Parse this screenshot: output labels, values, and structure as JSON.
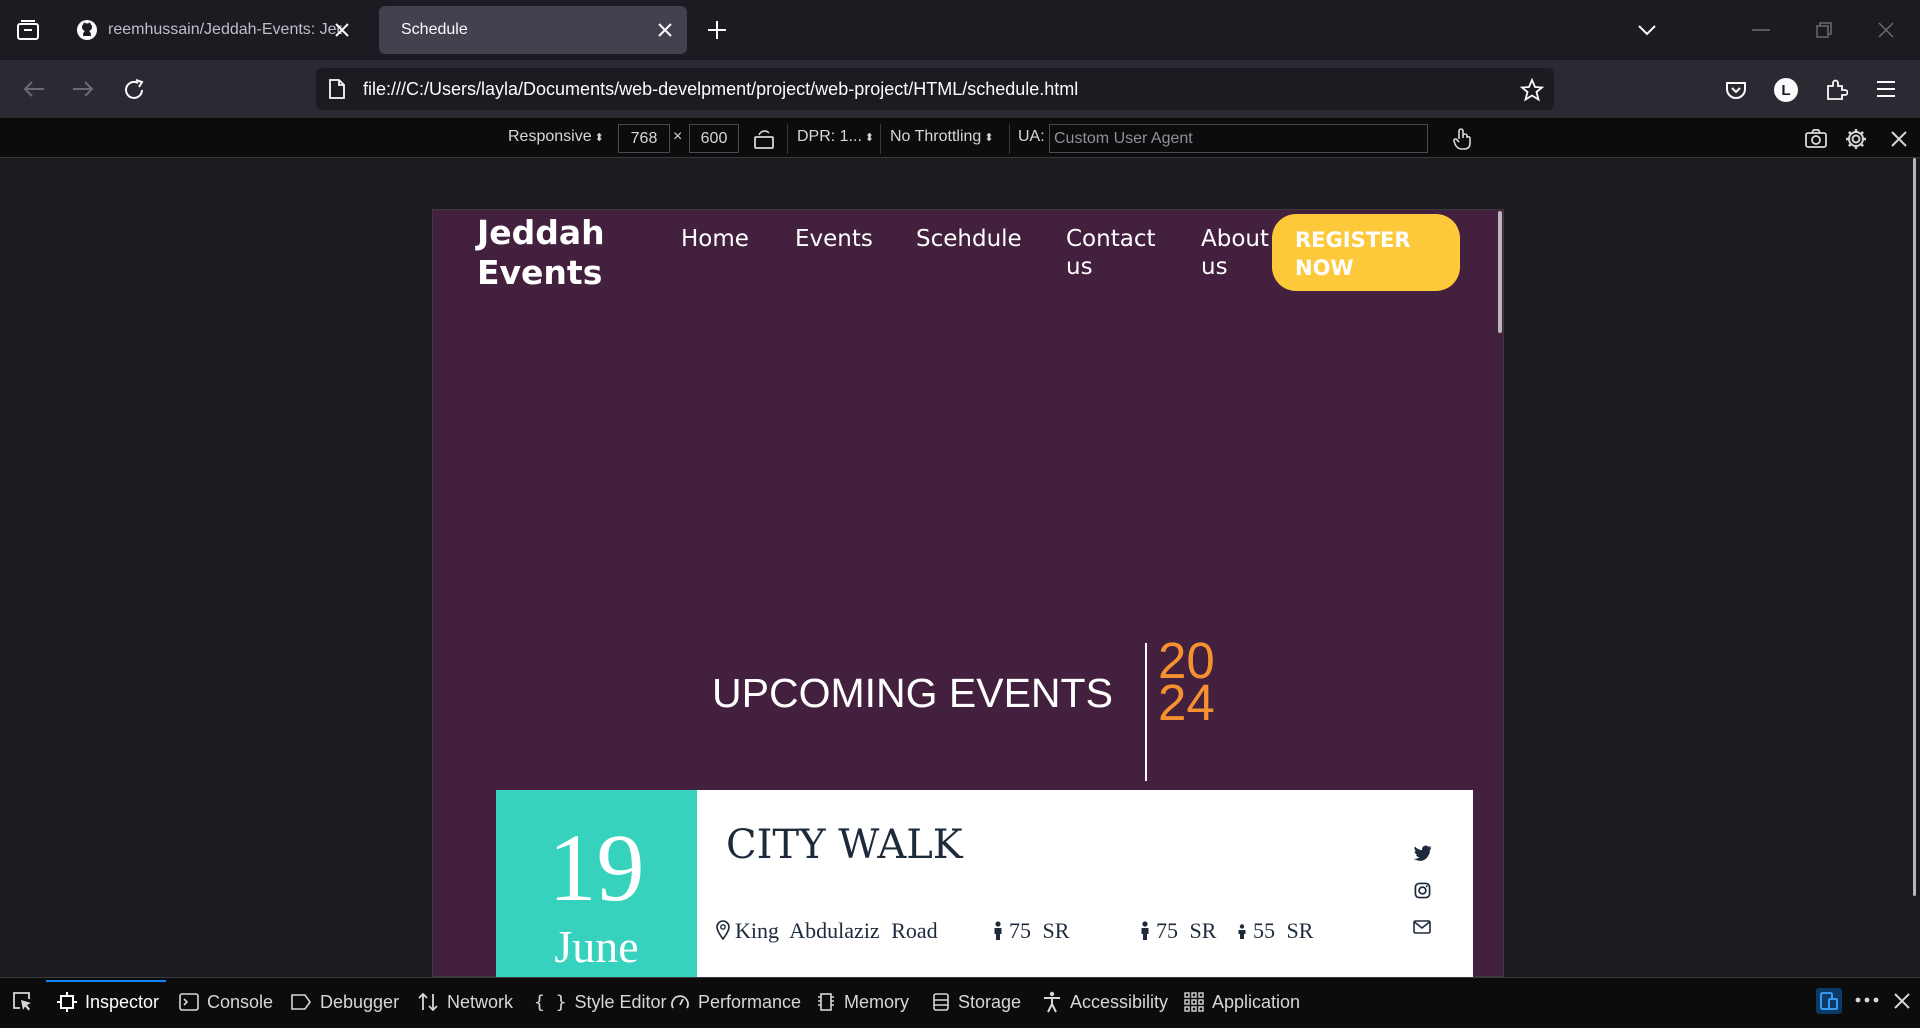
{
  "browser": {
    "tabs": [
      {
        "label": "reemhussain/Jeddah-Events: Jedd",
        "active": false
      },
      {
        "label": "Schedule",
        "active": true
      }
    ],
    "url": "file:///C:/Users/layla/Documents/web-develpment/project/web-project/HTML/schedule.html",
    "profile_initial": "L"
  },
  "rdm": {
    "device": "Responsive",
    "width": "768",
    "times": "×",
    "height": "600",
    "dpr": "DPR: 1...",
    "throttling": "No Throttling",
    "ua_label": "UA:",
    "ua_placeholder": "Custom User Agent"
  },
  "site": {
    "logo_line1": "Jeddah",
    "logo_line2": "Events",
    "nav": {
      "home": "Home",
      "events": "Events",
      "schedule": "Scehdule",
      "contact_1": "Contact",
      "contact_2": "us",
      "about_1": "About",
      "about_2": "us"
    },
    "register_1": "REGISTER",
    "register_2": "NOW",
    "upcoming": "UPCOMING EVENTS",
    "year_1": "20",
    "year_2": "24",
    "event": {
      "day": "19",
      "month": "June",
      "title": "CITY WALK",
      "location": "King Abdulaziz Road",
      "price_1": "75 SR",
      "price_2": "75 SR",
      "price_3": "55 SR"
    }
  },
  "devtools": {
    "tabs": [
      "Inspector",
      "Console",
      "Debugger",
      "Network",
      "Style Editor",
      "Performance",
      "Memory",
      "Storage",
      "Accessibility",
      "Application"
    ],
    "active_tab": "Inspector"
  },
  "colors": {
    "site_bg": "#42203e",
    "accent_yellow": "#fdc93a",
    "accent_teal": "#37d2bd",
    "accent_orange": "#f5922f",
    "devtools_active": "#0a84ff"
  }
}
